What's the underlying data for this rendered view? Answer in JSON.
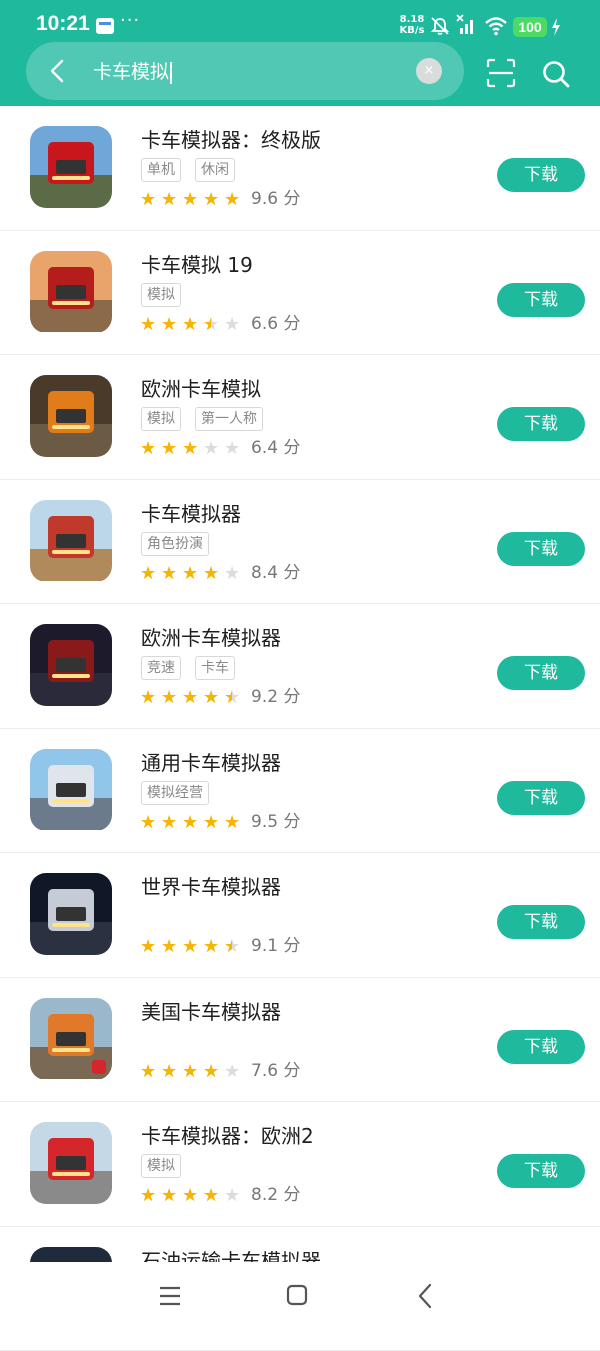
{
  "status_bar": {
    "time": "10:21",
    "more": "···",
    "net_speed_value": "8.18",
    "net_speed_unit": "KB/s",
    "battery": "100"
  },
  "search": {
    "query": "卡车模拟",
    "clear_label": "×"
  },
  "colors": {
    "primary": "#1fb99e",
    "star": "#f7b500",
    "star_empty": "#dcdcdc",
    "battery": "#4cd964"
  },
  "apps": [
    {
      "title": "卡车模拟器：终极版",
      "tags": [
        "单机",
        "休闲"
      ],
      "rating": 5,
      "score": "9.6 分",
      "button": "下载"
    },
    {
      "title": "卡车模拟 19",
      "tags": [
        "模拟"
      ],
      "rating": 3.5,
      "score": "6.6 分",
      "button": "下载"
    },
    {
      "title": "欧洲卡车模拟",
      "tags": [
        "模拟",
        "第一人称"
      ],
      "rating": 3,
      "score": "6.4 分",
      "button": "下载"
    },
    {
      "title": "卡车模拟器",
      "tags": [
        "角色扮演"
      ],
      "rating": 4,
      "score": "8.4 分",
      "button": "下载"
    },
    {
      "title": "欧洲卡车模拟器",
      "tags": [
        "竞速",
        "卡车"
      ],
      "rating": 4.5,
      "score": "9.2 分",
      "button": "下载"
    },
    {
      "title": "通用卡车模拟器",
      "tags": [
        "模拟经营"
      ],
      "rating": 5,
      "score": "9.5 分",
      "button": "下载"
    },
    {
      "title": "世界卡车模拟器",
      "tags": [],
      "rating": 4.5,
      "score": "9.1 分",
      "button": "下载"
    },
    {
      "title": "美国卡车模拟器",
      "tags": [],
      "rating": 4,
      "score": "7.6 分",
      "button": "下载"
    },
    {
      "title": "卡车模拟器：欧洲2",
      "tags": [
        "模拟"
      ],
      "rating": 4,
      "score": "8.2 分",
      "button": "下载"
    },
    {
      "title": "石油运输卡车模拟器",
      "tags": [],
      "rating": 0,
      "score": "",
      "button": ""
    }
  ]
}
